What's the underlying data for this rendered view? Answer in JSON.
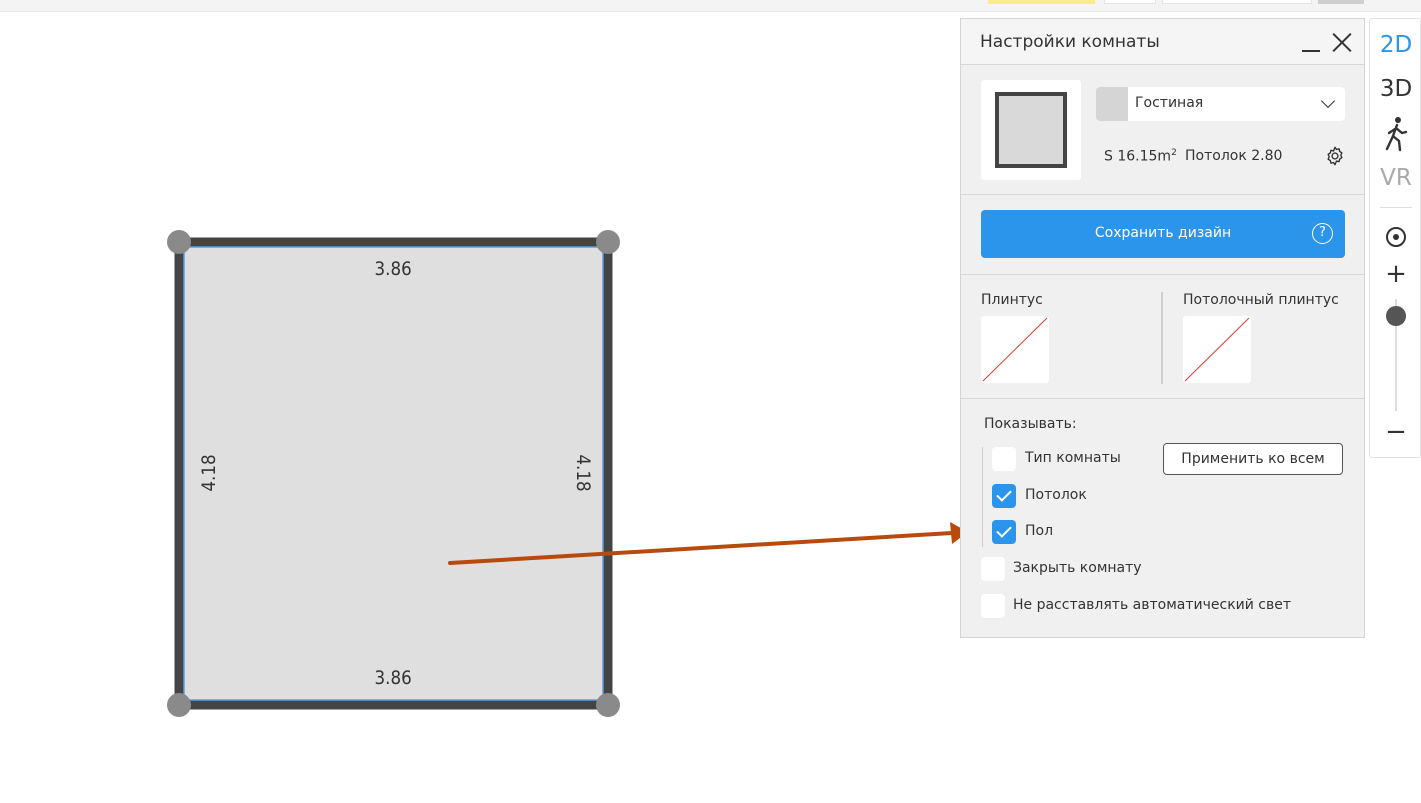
{
  "plan": {
    "dim_top": "3.86",
    "dim_bottom": "3.86",
    "dim_left": "4.18",
    "dim_right": "4.18"
  },
  "panel": {
    "title": "Настройки комнаты",
    "room_type": "Гостиная",
    "area_prefix": "S 16.15m",
    "area_sup": "2",
    "ceiling_height": "Потолок 2.80",
    "save_label": "Сохранить дизайн",
    "help_glyph": "?",
    "plinth_label": "Плинтус",
    "ceiling_plinth_label": "Потолочный плинтус",
    "show_label": "Показывать:",
    "apply_all_label": "Применить ко всем",
    "options": [
      {
        "label": "Тип комнаты",
        "checked": false
      },
      {
        "label": "Потолок",
        "checked": true
      },
      {
        "label": "Пол",
        "checked": true
      },
      {
        "label": "Закрыть комнату",
        "checked": false
      },
      {
        "label": "Не расставлять автоматический свет",
        "checked": false
      }
    ]
  },
  "toolbar": {
    "mode_2d": "2D",
    "mode_3d": "3D",
    "mode_vr": "VR",
    "zoom_in": "+",
    "zoom_out": "−",
    "walk_icon": "walk-icon",
    "target_icon": "target-icon"
  },
  "colors": {
    "accent": "#2b95eb",
    "wall": "#444444",
    "floor": "#dfdfdf",
    "arrow": "#b84a0e"
  }
}
